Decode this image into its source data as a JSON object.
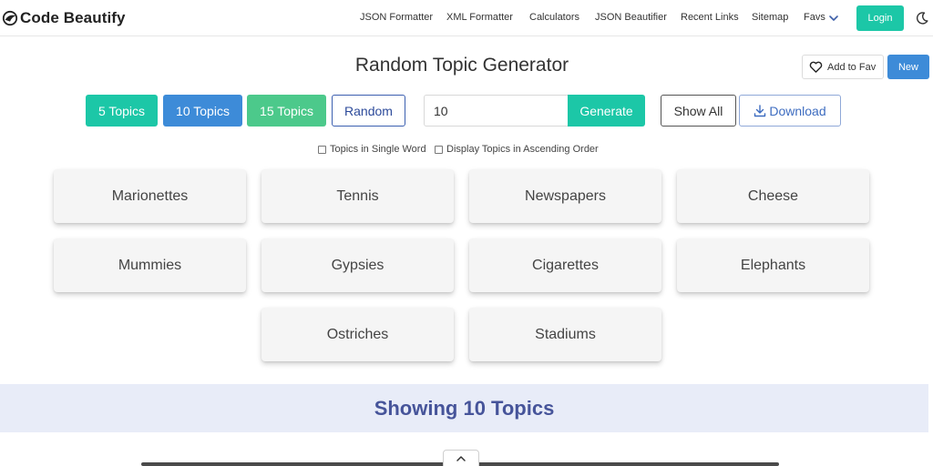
{
  "brand": {
    "name": "Code Beautify",
    "logo_icon": "code-beautify-logo-icon"
  },
  "nav": {
    "links": [
      {
        "id": "json-formatter",
        "label": "JSON Formatter"
      },
      {
        "id": "xml-formatter",
        "label": "XML Formatter"
      },
      {
        "id": "calculators",
        "label": "Calculators"
      },
      {
        "id": "json-beautifier",
        "label": "JSON Beautifier"
      },
      {
        "id": "recent-links",
        "label": "Recent Links"
      },
      {
        "id": "sitemap",
        "label": "Sitemap"
      },
      {
        "id": "favs",
        "label": "Favs"
      }
    ],
    "login_label": "Login",
    "theme_icon": "moon-icon"
  },
  "header": {
    "title": "Random Topic Generator",
    "add_fav_label": "Add to Fav",
    "new_label": "New"
  },
  "controls": {
    "preset_buttons": [
      {
        "id": "5-topics",
        "label": "5 Topics"
      },
      {
        "id": "10-topics",
        "label": "10 Topics"
      },
      {
        "id": "15-topics",
        "label": "15 Topics"
      },
      {
        "id": "random",
        "label": "Random"
      }
    ],
    "count_value": "10",
    "generate_label": "Generate",
    "show_all_label": "Show All",
    "download_label": "Download"
  },
  "options": {
    "single_word_label": "Topics in Single Word",
    "ascending_label": "Display Topics in Ascending Order"
  },
  "topics": [
    "Marionettes",
    "Tennis",
    "Newspapers",
    "Cheese",
    "Mummies",
    "Gypsies",
    "Cigarettes",
    "Elephants",
    "Ostriches",
    "Stadiums"
  ],
  "summary": {
    "text": "Showing 10 Topics"
  },
  "colors": {
    "teal": "#1cc7a7",
    "blue": "#3d8bd8",
    "green": "#4cc98b",
    "summary_band": "#e8ecf8",
    "summary_text": "#46549a"
  }
}
